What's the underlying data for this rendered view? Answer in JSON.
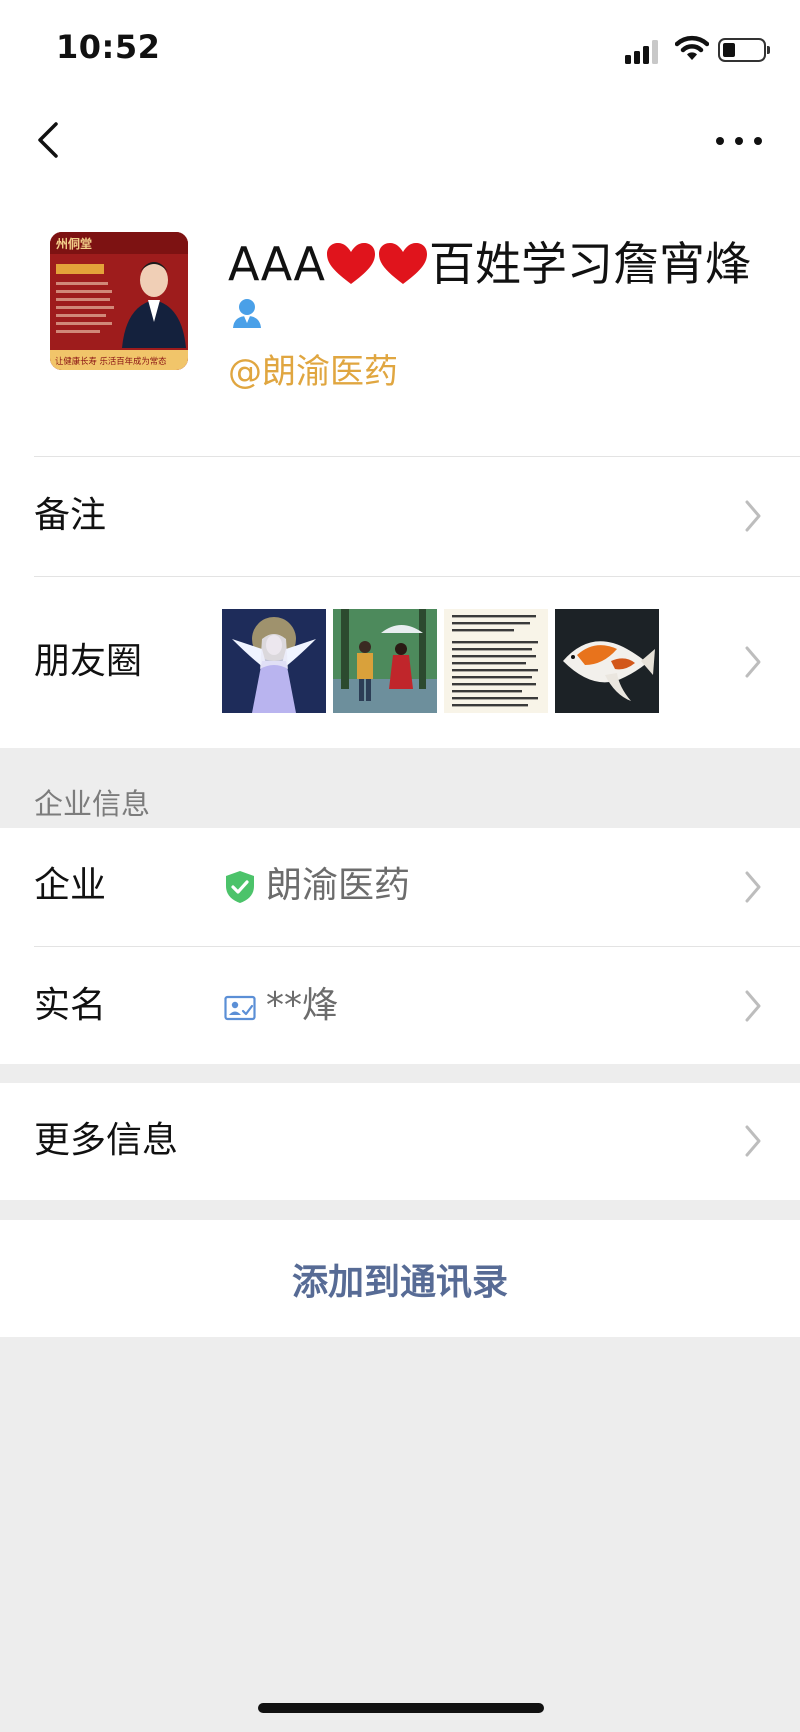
{
  "status_bar": {
    "time": "10:52"
  },
  "profile": {
    "name_prefix": "AAA",
    "name_suffix": "百姓学习詹宵烽",
    "corp_tag": "@朗渝医药",
    "avatar": {
      "brand": "州侗堂",
      "slogan": "让健康长寿 乐活百年成为常态"
    }
  },
  "rows": {
    "remark": {
      "label": "备注"
    },
    "moments": {
      "label": "朋友圈"
    }
  },
  "enterprise": {
    "section_title": "企业信息",
    "company": {
      "label": "企业",
      "value": "朗渝医药"
    },
    "real_name": {
      "label": "实名",
      "value": "**烽"
    }
  },
  "more_info": {
    "label": "更多信息"
  },
  "add_contact_label": "添加到通讯录",
  "colors": {
    "accent_gold": "#e0a640",
    "link_blue": "#576b95",
    "verified_green": "#4cc36a",
    "heart_red": "#e0141c"
  },
  "icons": {
    "back": "chevron-left-icon",
    "more": "more-dots-icon",
    "contact": "person-icon",
    "verified": "shield-check-icon",
    "id_card": "id-card-icon",
    "row_arrow": "chevron-right-icon"
  }
}
